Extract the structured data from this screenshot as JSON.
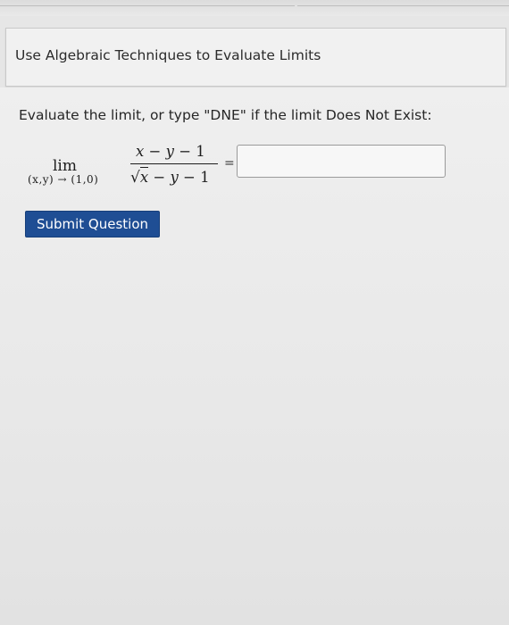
{
  "header": {
    "title": "Use Algebraic Techniques to Evaluate Limits"
  },
  "question": {
    "prompt": "Evaluate the limit, or type \"DNE\" if the limit Does Not Exist:",
    "limit": {
      "word": "lim",
      "approach": "(x,y) → (1,0)",
      "numerator_var1": "x",
      "numerator_minus1": " − ",
      "numerator_var2": "y",
      "numerator_rest": " − 1",
      "denominator_sqrt_var": "x",
      "denominator_minus": " − ",
      "denominator_var2": "y",
      "denominator_rest": " − 1"
    },
    "equals": "=",
    "answer": {
      "value": "",
      "placeholder": ""
    },
    "submit_label": "Submit Question"
  }
}
